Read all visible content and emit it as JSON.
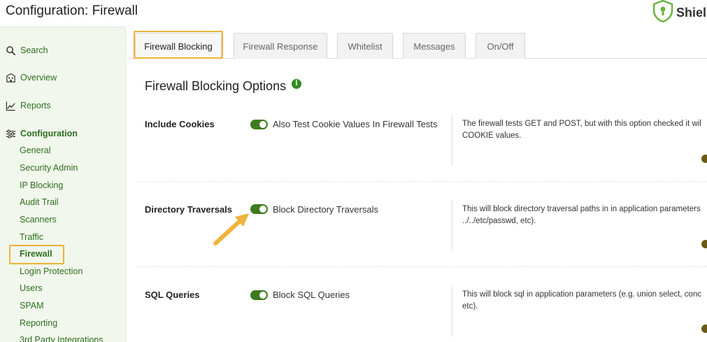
{
  "header": {
    "title": "Configuration: Firewall",
    "brand": "Shield"
  },
  "sidebar": {
    "items": [
      {
        "label": "Search",
        "icon": "search-icon"
      },
      {
        "label": "Overview",
        "icon": "building-icon"
      },
      {
        "label": "Reports",
        "icon": "chart-icon"
      },
      {
        "label": "Configuration",
        "icon": "sliders-icon"
      }
    ],
    "sub_items": [
      "General",
      "Security Admin",
      "IP Blocking",
      "Audit Trail",
      "Scanners",
      "Traffic",
      "Firewall",
      "Login Protection",
      "Users",
      "SPAM",
      "Reporting",
      "3rd Party Integrations"
    ],
    "current": "Firewall"
  },
  "tabs": [
    {
      "label": "Firewall Blocking",
      "active": true
    },
    {
      "label": "Firewall Response",
      "active": false
    },
    {
      "label": "Whitelist",
      "active": false
    },
    {
      "label": "Messages",
      "active": false
    },
    {
      "label": "On/Off",
      "active": false
    }
  ],
  "section": {
    "title": "Firewall Blocking Options",
    "info_icon": "i"
  },
  "options": [
    {
      "label": "Include Cookies",
      "toggle_text": "Also Test Cookie Values In Firewall Tests",
      "enabled": true,
      "desc_line1": "The firewall tests GET and POST, but with this option checked it wil",
      "desc_line2": "COOKIE values."
    },
    {
      "label": "Directory Traversals",
      "toggle_text": "Block Directory Traversals",
      "enabled": true,
      "desc_line1": "This will block directory traversal paths in in application parameters",
      "desc_line2": "../../etc/passwd, etc)."
    },
    {
      "label": "SQL Queries",
      "toggle_text": "Block SQL Queries",
      "enabled": true,
      "desc_line1": "This will block sql in application parameters (e.g. union select, conc",
      "desc_line2": "etc)."
    }
  ],
  "colors": {
    "accent_green": "#3f7b1e",
    "sidebar_bg": "#f1f7ec",
    "highlight": "#f0b23a"
  }
}
